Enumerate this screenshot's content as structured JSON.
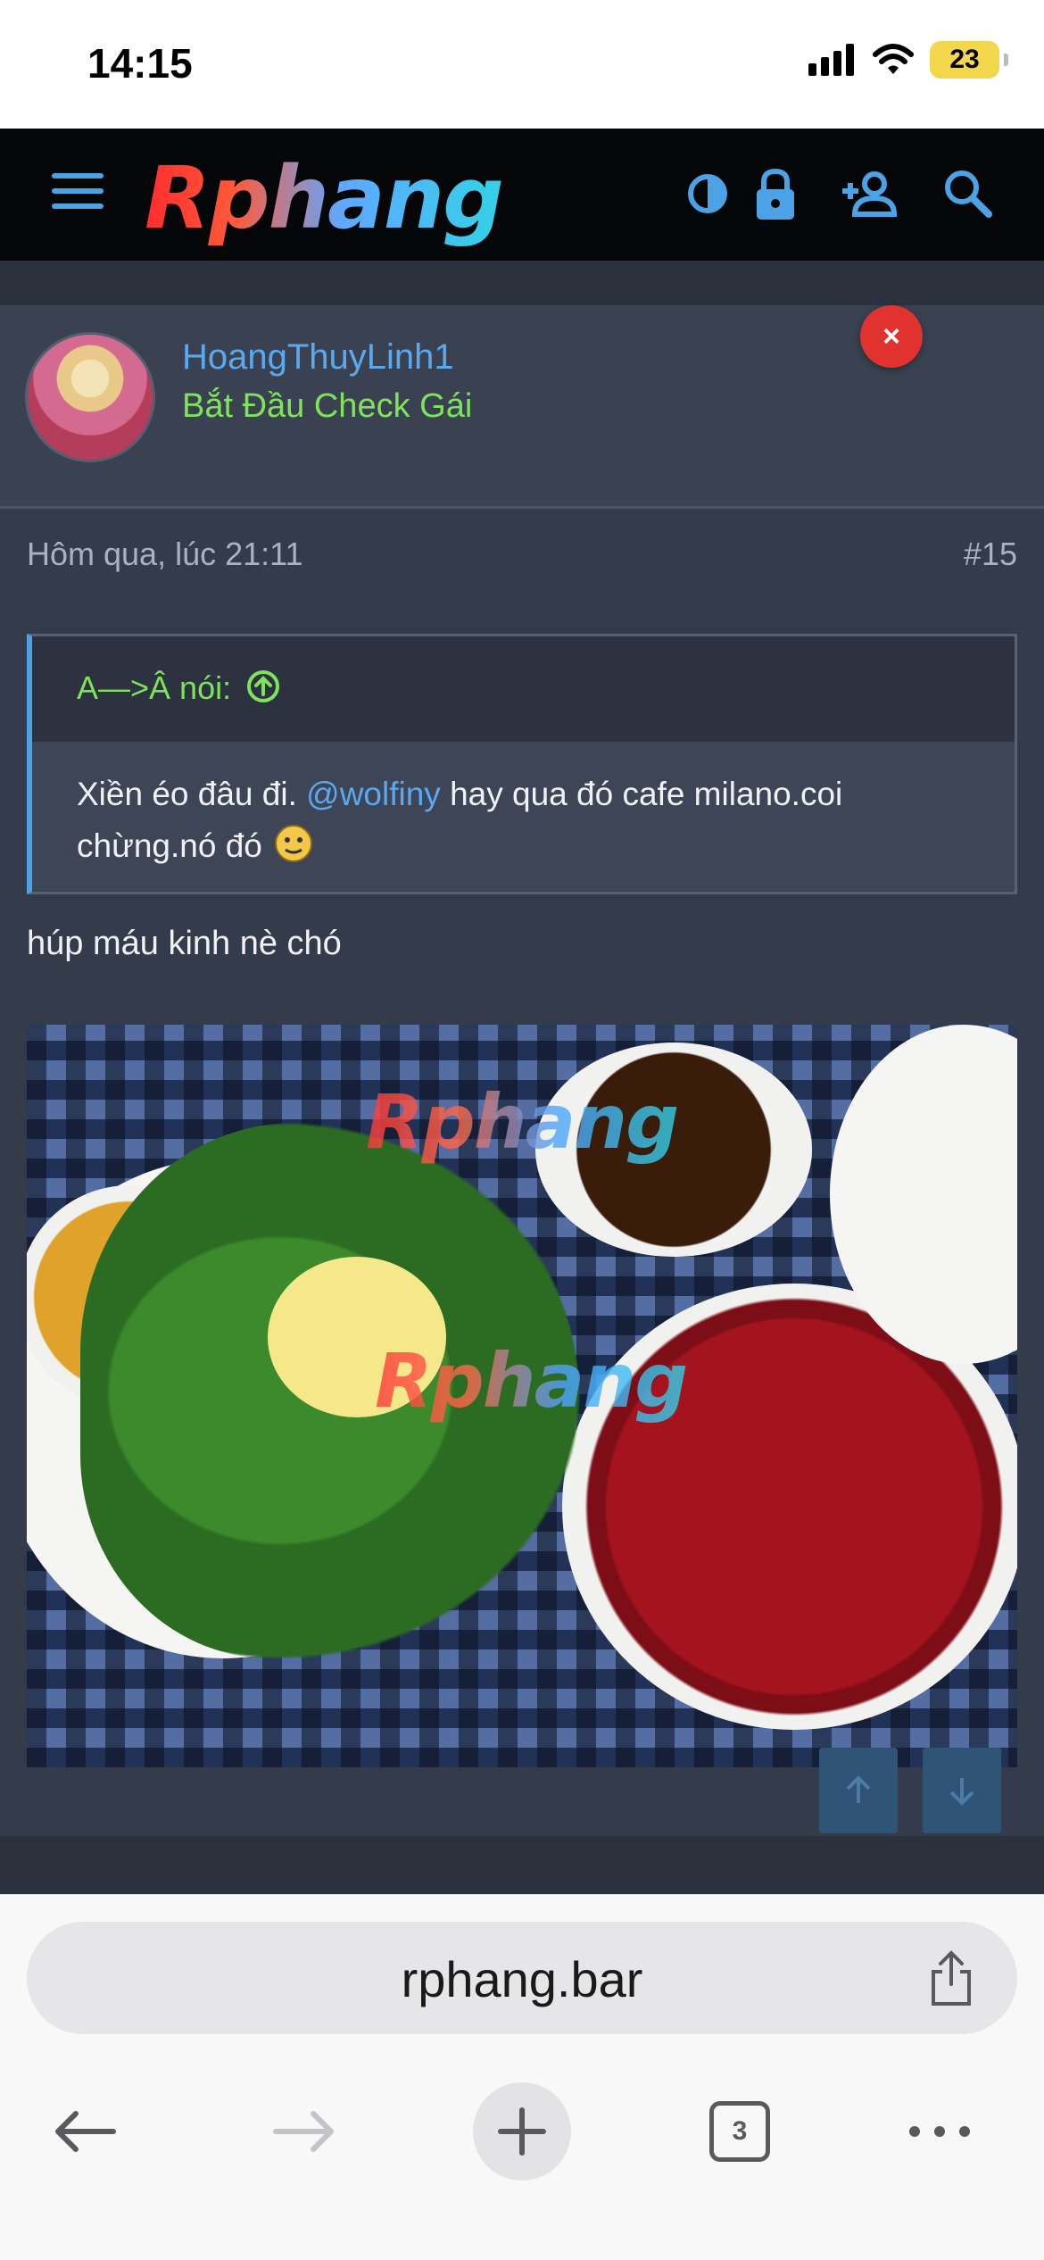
{
  "status_bar": {
    "time": "14:15",
    "battery": "23"
  },
  "header": {
    "logo": "Rphang"
  },
  "post": {
    "username": "HoangThuyLinh1",
    "user_title": "Bắt Đầu Check Gái",
    "close_label": "×",
    "date": "Hôm qua, lúc 21:11",
    "number": "#15",
    "quote": {
      "author": "A—>Â nói:",
      "text_before": "Xiền éo đâu đi.",
      "mention": "@wolfiny",
      "text_after": "hay qua đó cafe milano.coi chừng.nó đó"
    },
    "text": "húp máu kinh nè chó",
    "image_watermark": "Rphang"
  },
  "browser": {
    "url": "rphang.bar",
    "tabs_count": "3"
  },
  "colors": {
    "accent_blue": "#4ba3e6",
    "user_title_green": "#7ee35a",
    "close_red": "#e0322e",
    "card_bg": "#343b4a"
  },
  "icons": [
    "hamburger-icon",
    "contrast-icon",
    "lock-icon",
    "add-user-icon",
    "search-icon",
    "share-icon",
    "back-icon",
    "forward-icon",
    "plus-icon",
    "more-icon"
  ]
}
